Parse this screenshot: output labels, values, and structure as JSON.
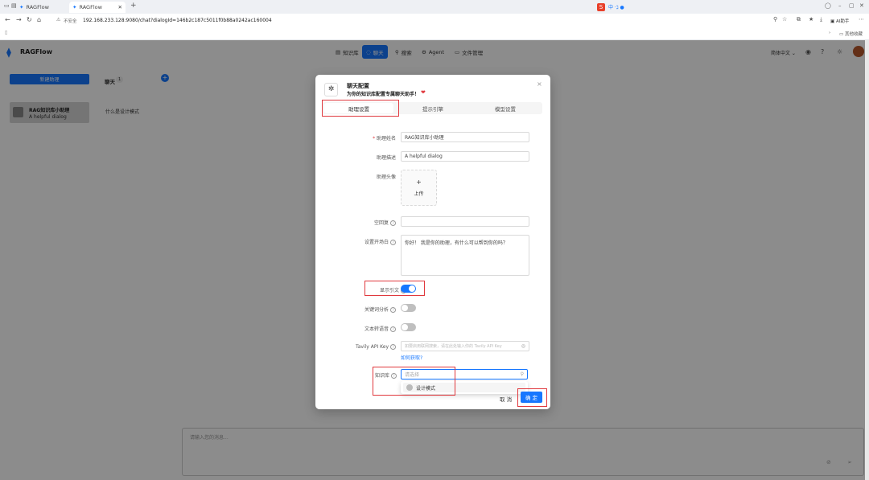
{
  "browser": {
    "tabs": [
      {
        "label": "RAGFlow"
      },
      {
        "label": "RAGFlow"
      }
    ],
    "new_tab_symbol": "+",
    "security_label": "不安全",
    "url": "192.168.233.128:9080/chat?dialogId=146b2c187c5011f0b88a0242ac160004",
    "bookmark_label": "其他收藏",
    "profile_label": "AI助手"
  },
  "app": {
    "logo_text": "RAGFlow",
    "nav": [
      {
        "label": "知识库",
        "icon": "database-icon"
      },
      {
        "label": "聊天",
        "icon": "chat-icon"
      },
      {
        "label": "搜索",
        "icon": "search-icon"
      },
      {
        "label": "Agent",
        "icon": "agent-icon"
      },
      {
        "label": "文件管理",
        "icon": "folder-icon"
      }
    ],
    "language": "简体中文",
    "accent_color": "#1677ff"
  },
  "sidebar": {
    "new_chat": "新建助理",
    "chats_label": "聊天",
    "chats_count": "1",
    "assistant_name": "RAG知识库小助理",
    "assistant_desc": "A helpful dialog",
    "conversation_item": "什么是设计模式",
    "message_placeholder": "请输入您的消息..."
  },
  "modal": {
    "title": "聊天配置",
    "subtitle": "为你的知识库配置专属聊天助手！",
    "tabs": [
      "助理设置",
      "提示引擎",
      "模型设置"
    ],
    "fields": {
      "name_label": "助理姓名",
      "name_value": "RAG知识库小助理",
      "desc_label": "助理描述",
      "desc_value": "A helpful dialog",
      "avatar_label": "助理头像",
      "upload_plus": "+",
      "upload_label": "上传",
      "empty_label": "空回复",
      "opener_label": "设置开场白",
      "opener_value": "你好！ 我是你的助理，有什么可以帮到你的吗？",
      "quote_label": "显示引文",
      "keyword_label": "关键词分析",
      "tts_label": "文本转语音",
      "tavily_label": "Tavily API Key",
      "tavily_placeholder": "如要启用联网搜索，请在此处输入你的 Tavily API Key",
      "tavily_link": "如何获取?",
      "kb_label": "知识库",
      "kb_placeholder": "请选择",
      "kb_option": "设计模式"
    },
    "toggles": {
      "quote": true,
      "keyword": false,
      "tts": false
    },
    "cancel": "取 消",
    "confirm": "确 定"
  }
}
